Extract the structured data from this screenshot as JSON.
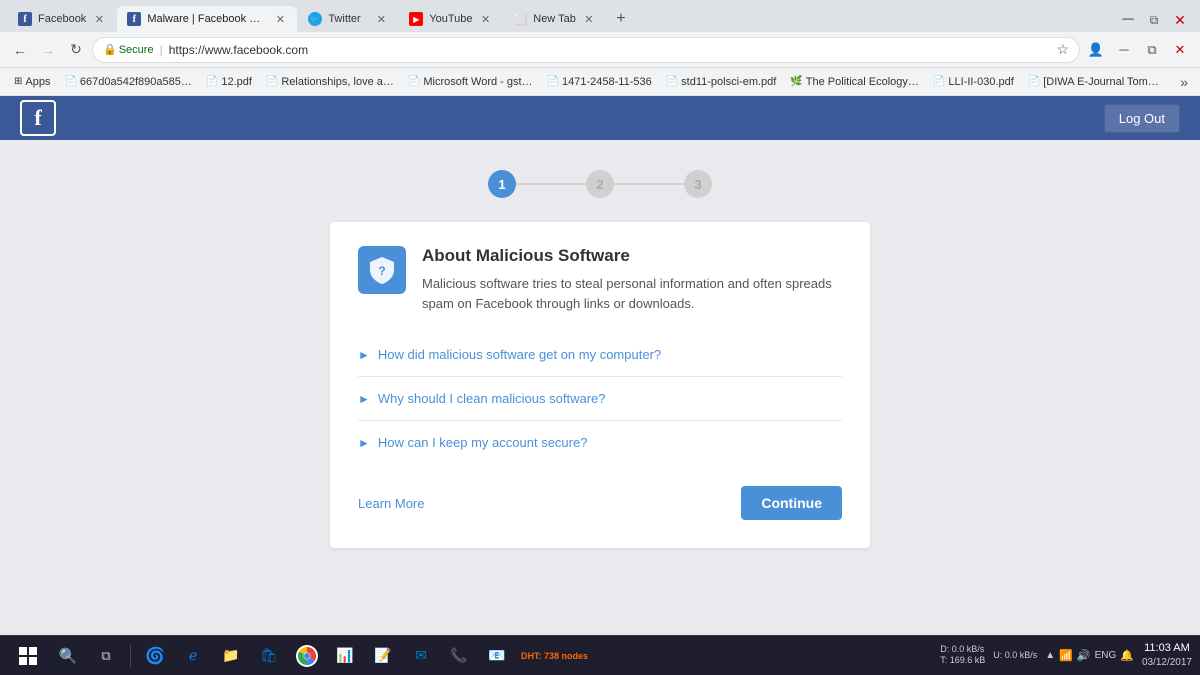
{
  "browser": {
    "tabs": [
      {
        "id": "tab-facebook",
        "label": "Facebook",
        "favicon": "fb",
        "active": false,
        "closable": true
      },
      {
        "id": "tab-malware",
        "label": "Malware | Facebook Hel…",
        "favicon": "fb",
        "active": true,
        "closable": true
      },
      {
        "id": "tab-twitter",
        "label": "Twitter",
        "favicon": "tw",
        "active": false,
        "closable": true
      },
      {
        "id": "tab-youtube",
        "label": "YouTube",
        "favicon": "yt",
        "active": false,
        "closable": true
      },
      {
        "id": "tab-newtab",
        "label": "New Tab",
        "favicon": "",
        "active": false,
        "closable": true
      }
    ],
    "url": "https://www.facebook.com",
    "secure_label": "Secure",
    "back_disabled": false,
    "forward_disabled": true
  },
  "bookmarks": [
    {
      "label": "Apps",
      "icon": "⊞"
    },
    {
      "label": "667d0a542f890a585…",
      "icon": "📄"
    },
    {
      "label": "12.pdf",
      "icon": "📄"
    },
    {
      "label": "Relationships, love a…",
      "icon": "📄"
    },
    {
      "label": "Microsoft Word - gst…",
      "icon": "📄"
    },
    {
      "label": "1471-2458-11-536",
      "icon": "📄"
    },
    {
      "label": "std11-polsci-em.pdf",
      "icon": "📄"
    },
    {
      "label": "The Political Ecology…",
      "icon": "🌿"
    },
    {
      "label": "LLI-II-030.pdf",
      "icon": "📄"
    },
    {
      "label": "[DIWA E-Journal Tom…",
      "icon": "📄"
    }
  ],
  "fb_header": {
    "logo": "f",
    "logout_label": "Log Out"
  },
  "steps": [
    {
      "number": "1",
      "active": true
    },
    {
      "number": "2",
      "active": false
    },
    {
      "number": "3",
      "active": false
    }
  ],
  "card": {
    "title": "About Malicious Software",
    "description": "Malicious software tries to steal personal information and often spreads spam on Facebook through links or downloads.",
    "faq_items": [
      {
        "label": "How did malicious software get on my computer?"
      },
      {
        "label": "Why should I clean malicious software?"
      },
      {
        "label": "How can I keep my account secure?"
      }
    ],
    "learn_more_label": "Learn More",
    "continue_label": "Continue"
  },
  "taskbar": {
    "time": "11:03 AM",
    "date": "03/12/2017",
    "dht_label": "DHT: 738 nodes",
    "network_dl": "D: 0.0 kB/s",
    "network_ul": "T: 169.6 kB",
    "network2": "U: 0.0 kB/s",
    "lang": "ENG"
  }
}
